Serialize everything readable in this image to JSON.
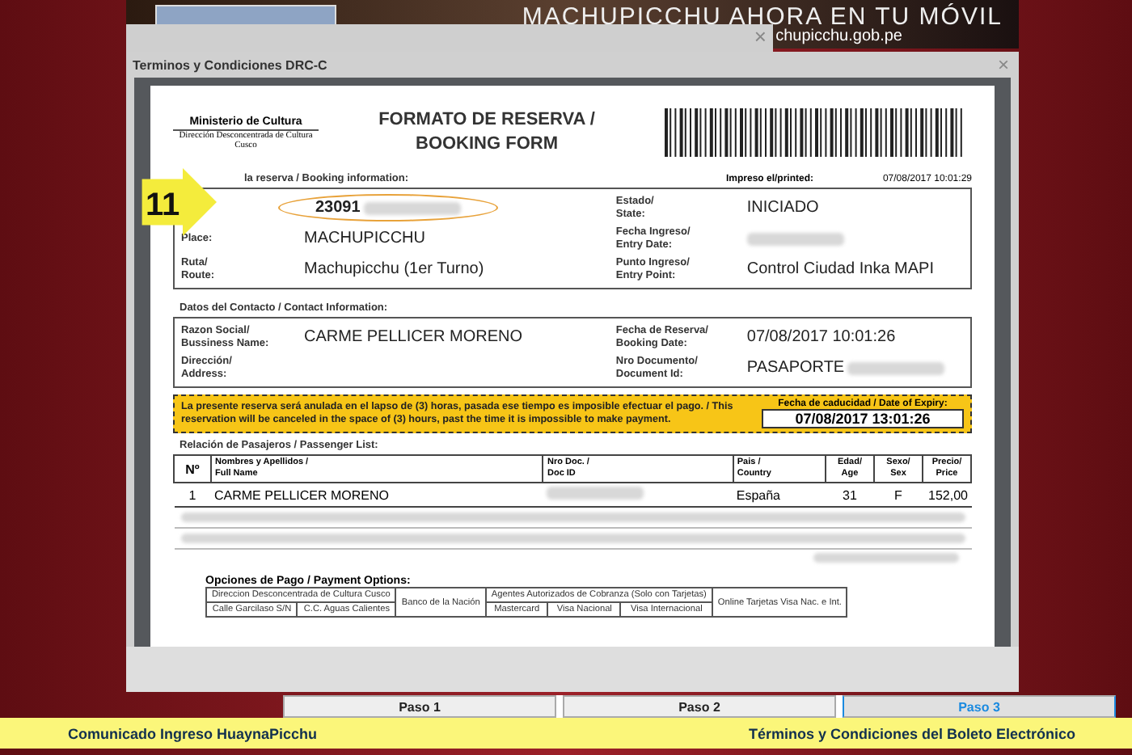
{
  "banner": {
    "title": "MACHUPICCHU AHORA EN TU MÓVIL",
    "url": "chupicchu.gob.pe"
  },
  "back_dialog": {
    "close": "×"
  },
  "dialog": {
    "title": "Terminos y Condiciones DRC-C",
    "close": "×"
  },
  "step_badge": "11",
  "document": {
    "ministry": "Ministerio de Cultura",
    "ministry_sub": "Dirección Desconcentrada de Cultura Cusco",
    "title_lines": [
      "FORMATO DE RESERVA /",
      "BOOKING FORM"
    ],
    "booking": {
      "label": "la reserva / Booking information:",
      "printed_label": "Impreso el/printed:",
      "printed_value": "07/08/2017 10:01:29",
      "left": [
        {
          "value": "23091",
          "blurred": true,
          "circled": true
        },
        {
          "lines": [
            "Place:"
          ],
          "value": "MACHUPICCHU",
          "blurred": false,
          "circled": false
        },
        {
          "lines": [
            "Ruta/",
            "Route:"
          ],
          "value": "Machupicchu (1er Turno)",
          "blurred": false,
          "circled": false
        }
      ],
      "right": [
        {
          "lines": [
            "Estado/",
            "State:"
          ],
          "value": "INICIADO",
          "blurred": false
        },
        {
          "lines": [
            "Fecha Ingreso/",
            "Entry Date:"
          ],
          "blurred": true
        },
        {
          "lines": [
            "Punto Ingreso/",
            "Entry Point:"
          ],
          "value": "Control Ciudad Inka MAPI",
          "blurred": false
        }
      ]
    },
    "contact": {
      "label": "Datos del Contacto / Contact Information:",
      "left": [
        {
          "lines": [
            "Razon Social/",
            "Bussiness Name:"
          ],
          "value": "CARME PELLICER MORENO",
          "blurred": false
        },
        {
          "lines": [
            "Dirección/",
            "Address:"
          ],
          "blurred": false
        }
      ],
      "right": [
        {
          "lines": [
            "Fecha de Reserva/",
            "Booking Date:"
          ],
          "value": "07/08/2017 10:01:26",
          "blurred": false
        },
        {
          "lines": [
            "Nro Documento/",
            "Document Id:"
          ],
          "value": "PASAPORTE",
          "blurred": true
        }
      ]
    },
    "warning": {
      "text": "La presente reserva será anulada en el lapso de (3) horas, pasada ese tiempo es imposible efectuar el pago. / This reservation will be canceled in the space of (3) hours, past the time it is impossible to make payment.",
      "expiry_label": "Fecha de caducidad / Date of Expiry:",
      "expiry_value": "07/08/2017 13:01:26"
    },
    "passengers": {
      "label": "Relación de Pasajeros / Passenger List:",
      "columns": [
        [
          "Nº"
        ],
        [
          "Nombres y Apellidos /",
          "Full Name"
        ],
        [
          "Nro Doc. /",
          "Doc ID"
        ],
        [
          "Pais /",
          "Country"
        ],
        [
          "Edad/",
          "Age"
        ],
        [
          "Sexo/",
          "Sex"
        ],
        [
          "Precio/",
          "Price"
        ]
      ],
      "rows": [
        {
          "blurred": false,
          "no": "1",
          "name": "CARME PELLICER MORENO",
          "doc_blurred": true,
          "country": "España",
          "age": "31",
          "sex": "F",
          "price": "152,00"
        },
        {
          "blurred": true
        },
        {
          "blurred": true
        }
      ],
      "total_blurred": true
    },
    "payment": {
      "title": "Opciones de Pago / Payment Options:",
      "group_1": "Direccion Desconcentrada de Cultura Cusco",
      "bank": "Banco de la Nación",
      "group_2": "Agentes Autorizados de Cobranza (Solo con Tarjetas)",
      "online": "Online Tarjetas Visa Nac. e Int.",
      "sub_1": [
        "Calle Garcilaso S/N",
        "C.C. Aguas Calientes"
      ],
      "sub_2": [
        "Mastercard",
        "Visa Nacional",
        "Visa Internacional"
      ]
    }
  },
  "steps": [
    {
      "label": "Paso 1",
      "selected": false
    },
    {
      "label": "Paso 2",
      "selected": false
    },
    {
      "label": "Paso 3",
      "selected": true
    }
  ],
  "links": [
    "Comunicado Ingreso HuaynaPicchu",
    "Términos y Condiciones del Boleto Electrónico"
  ]
}
